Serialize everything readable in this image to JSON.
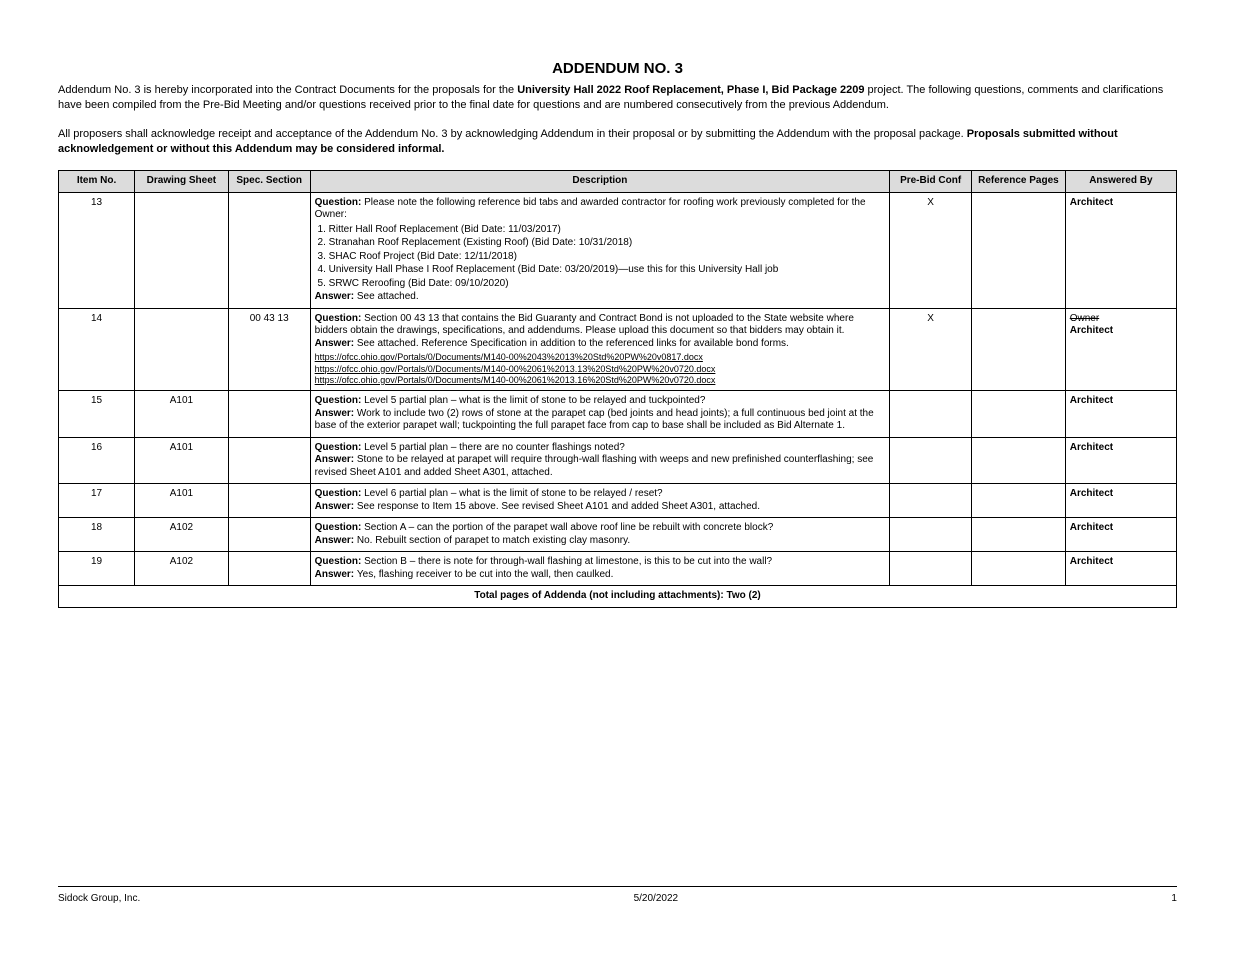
{
  "title": "ADDENDUM NO. 3",
  "preamble": {
    "p1": "Addendum No. 3 is hereby incorporated into the Contract Documents for the proposals for the ",
    "project_label": "University Hall 2022 Roof Replacement, Phase I, Bid Package 2209 ",
    "p1b": "project. The following questions, comments and clarifications have been compiled from the Pre-Bid Meeting and/or questions received prior to the final date for questions and are numbered consecutively from the previous Addendum.",
    "p2a": "All proposers shall acknowledge receipt and acceptance of the Addendum No. 3 by acknowledging Addendum in their proposal or by submitting the Addendum with the proposal package. ",
    "p2b": "Proposals submitted without acknowledgement or without this Addendum may be considered informal."
  },
  "headers": [
    "Item No.",
    "Drawing Sheet",
    "Spec. Section",
    "Description",
    "Pre-Bid Conf",
    "Reference Pages",
    "Answered By"
  ],
  "rows": [
    {
      "item": "13",
      "drawing": "",
      "spec": "",
      "desc": {
        "q": "Question: ",
        "qt": "Please note the following reference bid tabs and awarded contractor for roofing work previously completed for the Owner:",
        "bullets": [
          "Ritter Hall Roof Replacement (Bid Date: 11/03/2017)",
          "Stranahan Roof Replacement (Existing Roof) (Bid Date: 10/31/2018)",
          "SHAC Roof Project (Bid Date: 12/11/2018)",
          "University Hall Phase I Roof Replacement (Bid Date: 03/20/2019)—use this for this University Hall job",
          "SRWC Reroofing (Bid Date: 09/10/2020)"
        ],
        "a": "Answer: ",
        "at": "See attached."
      },
      "prebid": "X",
      "ref": "",
      "ans": "Architect"
    },
    {
      "item": "14",
      "drawing": "",
      "spec": "00 43 13",
      "desc": {
        "q": "Question: ",
        "qt": "Section 00 43 13 that contains the Bid Guaranty and Contract Bond is not uploaded to the State website where bidders obtain the drawings, specifications, and addendums. Please upload this document so that bidders may obtain it.",
        "a": "Answer: ",
        "at": "See attached. Reference Specification in addition to the referenced links for available bond forms.",
        "links": [
          "https://ofcc.ohio.gov/Portals/0/Documents/M140-00%2043%2013%20Std%20PW%20v0817.docx",
          "https://ofcc.ohio.gov/Portals/0/Documents/M140-00%2061%2013.13%20Std%20PW%20v0720.docx",
          "https://ofcc.ohio.gov/Portals/0/Documents/M140-00%2061%2013.16%20Std%20PW%20v0720.docx"
        ]
      },
      "prebid": "X",
      "ref": "",
      "ans": "Architect",
      "struck": "Owner"
    },
    {
      "item": "15",
      "drawing": "A101",
      "spec": "",
      "desc": {
        "q": "Question: ",
        "qt": "Level 5 partial plan – what is the limit of stone to be relayed and tuckpointed?",
        "a": "Answer: ",
        "at": "Work to include two (2) rows of stone at the parapet cap (bed joints and head joints); a full continuous bed joint at the base of the exterior parapet wall; tuckpointing the full parapet face from cap to base shall be included as Bid Alternate 1."
      },
      "prebid": "",
      "ref": "",
      "ans": "Architect"
    },
    {
      "item": "16",
      "drawing": "A101",
      "spec": "",
      "desc": {
        "q": "Question: ",
        "qt": "Level 5 partial plan – there are no counter flashings noted?",
        "a": "Answer: ",
        "at": "Stone to be relayed at parapet will require through-wall flashing with weeps and new prefinished counterflashing; see revised Sheet A101 and added Sheet A301, attached."
      },
      "prebid": "",
      "ref": "",
      "ans": "Architect"
    },
    {
      "item": "17",
      "drawing": "A101",
      "spec": "",
      "desc": {
        "q": "Question: ",
        "qt": "Level 6 partial plan – what is the limit of stone to be relayed / reset?",
        "a": "Answer: ",
        "at": "See response to Item 15 above. See revised Sheet A101 and added Sheet A301, attached."
      },
      "prebid": "",
      "ref": "",
      "ans": "Architect"
    },
    {
      "item": "18",
      "drawing": "A102",
      "spec": "",
      "desc": {
        "q": "Question: ",
        "qt": "Section A – can the portion of the parapet wall above roof line be rebuilt with concrete block?",
        "a": "Answer: ",
        "at": "No. Rebuilt section of parapet to match existing clay masonry."
      },
      "prebid": "",
      "ref": "",
      "ans": "Architect"
    },
    {
      "item": "19",
      "drawing": "A102",
      "spec": "",
      "desc": {
        "q": "Question: ",
        "qt": "Section B – there is note for through-wall flashing at limestone, is this to be cut into the wall?",
        "a": "Answer: ",
        "at": "Yes, flashing receiver to be cut into the wall, then caulked."
      },
      "prebid": "",
      "ref": "",
      "ans": "Architect"
    }
  ],
  "total_label": "Total pages of Addenda (not including attachments): Two (2)",
  "footer_left": "Sidock Group, Inc.",
  "footer_center": "5/20/2022",
  "footer_right": "1"
}
